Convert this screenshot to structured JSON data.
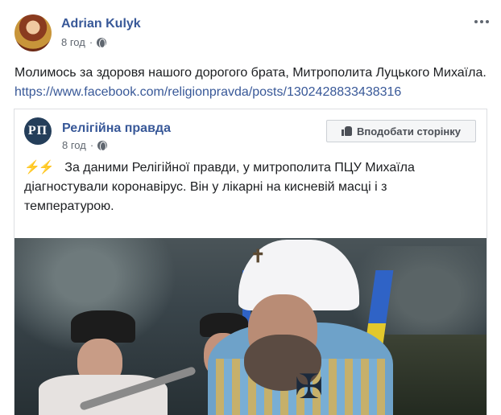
{
  "post": {
    "author": "Adrian Kulyk",
    "time": "8 год",
    "separator": "·",
    "text": "Молимось за здоровя нашого дорогого брата, Митрополита Луцького Михаїла.",
    "link": "https://www.facebook.com/religionpravda/posts/1302428833438316"
  },
  "shared": {
    "page_name": "Релігійна правда",
    "page_logo_text": "РП",
    "time": "8 год",
    "separator": "·",
    "like_page_label": "Вподобати сторінку",
    "emoji": "⚡⚡",
    "text": "За даними Релігійної правди, у митрополита ПЦУ Михаїла діагностували коронавірус. Він у лікарні на кисневій масці і з температурою."
  },
  "icons": {
    "privacy": "globe-icon",
    "more": "more-options-icon",
    "like": "thumbs-up-icon"
  },
  "colors": {
    "link": "#385898",
    "meta": "#606770",
    "flag_blue": "#2f63c6",
    "flag_yellow": "#e3c82c"
  }
}
